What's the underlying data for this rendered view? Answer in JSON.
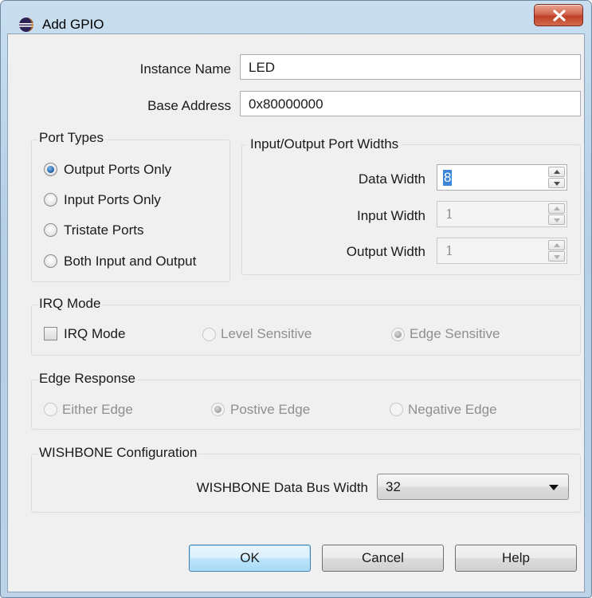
{
  "window": {
    "title": "Add GPIO",
    "close_icon": "close-icon"
  },
  "fields": {
    "instance_name_label": "Instance Name",
    "instance_name_value": "LED",
    "base_address_label": "Base Address",
    "base_address_value": "0x80000000"
  },
  "port_types": {
    "title": "Port Types",
    "options": [
      "Output Ports Only",
      "Input Ports Only",
      "Tristate Ports",
      "Both Input and Output"
    ],
    "selected": "Output Ports Only"
  },
  "port_widths": {
    "title": "Input/Output Port Widths",
    "data_width_label": "Data Width",
    "data_width_value": "8",
    "input_width_label": "Input Width",
    "input_width_value": "1",
    "output_width_label": "Output Width",
    "output_width_value": "1"
  },
  "irq": {
    "title": "IRQ Mode",
    "checkbox_label": "IRQ Mode",
    "checked": false,
    "level_label": "Level Sensitive",
    "edge_label": "Edge Sensitive",
    "selected": "Edge Sensitive"
  },
  "edge_response": {
    "title": "Edge Response",
    "either_label": "Either Edge",
    "positive_label": "Postive Edge",
    "negative_label": "Negative Edge",
    "selected": "Postive Edge"
  },
  "wishbone": {
    "title": "WISHBONE Configuration",
    "bus_width_label": "WISHBONE Data Bus Width",
    "bus_width_value": "32"
  },
  "buttons": {
    "ok": "OK",
    "cancel": "Cancel",
    "help": "Help"
  },
  "colors": {
    "accent": "#3a86d8",
    "titlebar": "#c9dff0",
    "close": "#c04127"
  }
}
